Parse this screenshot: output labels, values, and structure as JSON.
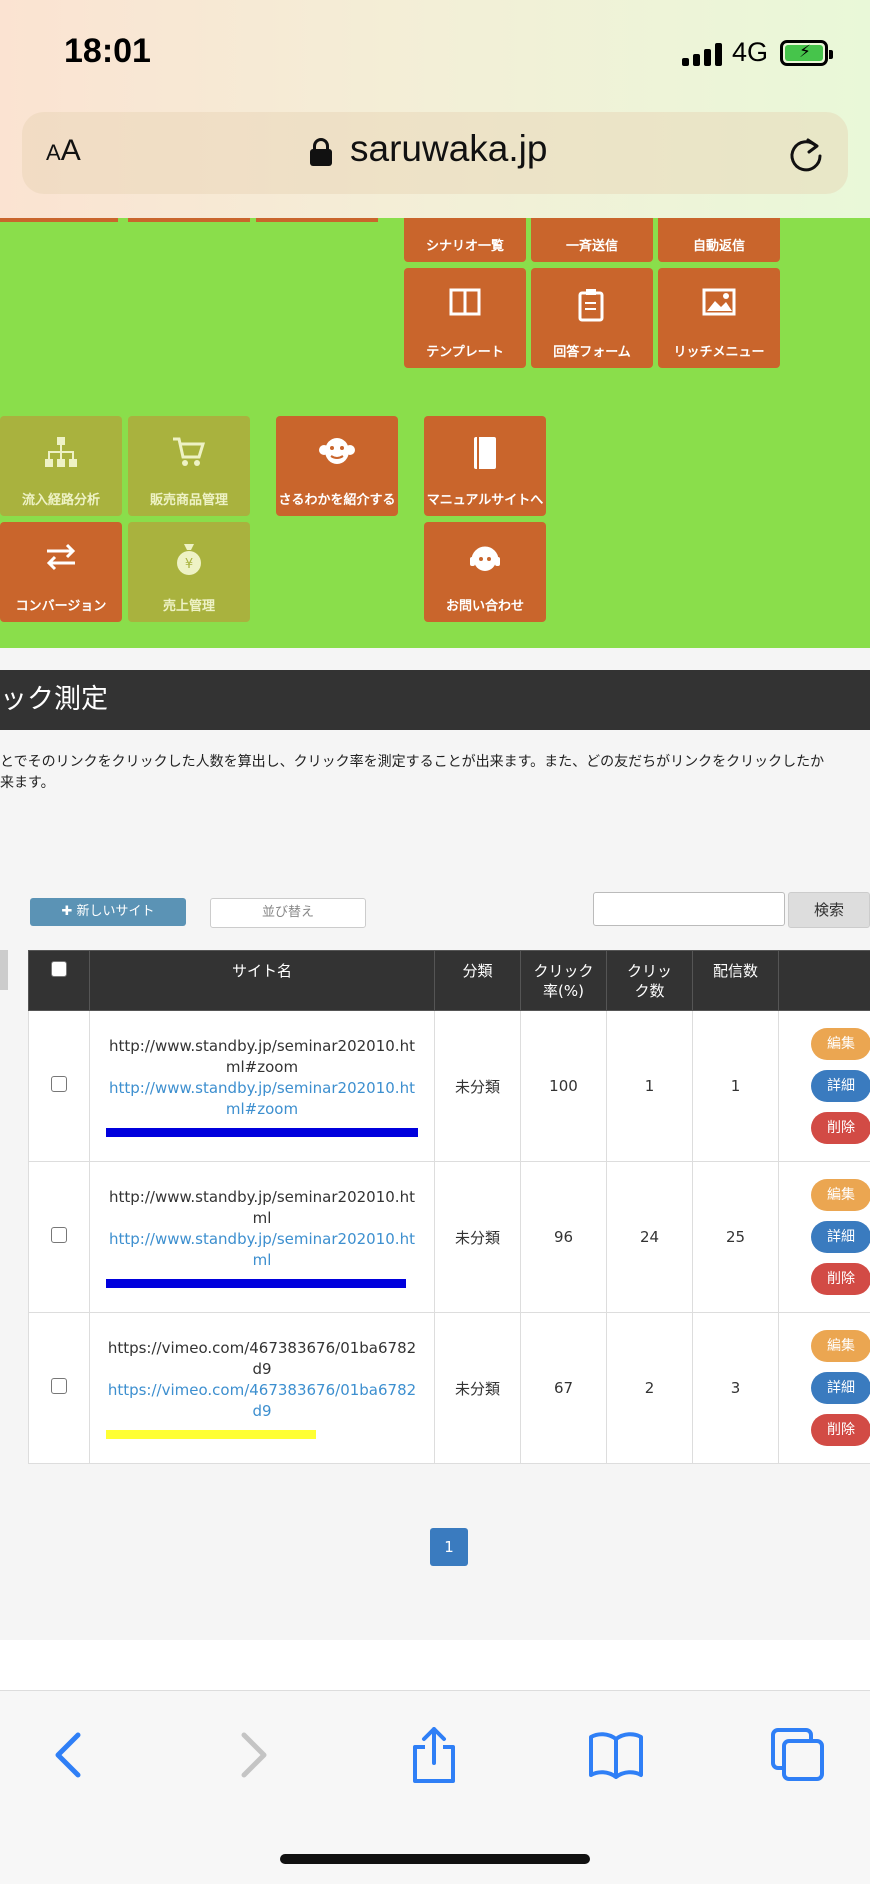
{
  "status_bar": {
    "time": "18:01",
    "network": "4G"
  },
  "browser": {
    "text_size_label": "AA",
    "domain": "saruwaka.jp"
  },
  "menu_tiles": {
    "row_top": [
      "シナリオ一覧",
      "一斉送信",
      "自動返信"
    ],
    "row_second": [
      "テンプレート",
      "回答フォーム",
      "リッチメニュー"
    ],
    "row_third": [
      "流入経路分析",
      "販売商品管理",
      "さるわかを紹介する",
      "マニュアルサイトへ"
    ],
    "row_fourth": [
      "コンバージョン",
      "売上管理",
      "お問い合わせ"
    ]
  },
  "page": {
    "title": "ック測定",
    "description_line1": "とでそのリンクをクリックした人数を算出し、クリック率を測定することが出来ます。また、どの友だちがリンクをクリックしたか",
    "description_line2": "来ます。"
  },
  "toolbar": {
    "new_site_label": "新しいサイト",
    "sort_label": "並び替え",
    "search_value": "",
    "search_button": "検索"
  },
  "table": {
    "headers": {
      "site": "サイト名",
      "category": "分類",
      "click_rate": "クリック率(%)",
      "clicks": "クリック数",
      "deliveries": "配信数"
    },
    "rows": [
      {
        "title": "http://www.standby.jp/seminar202010.html#zoom",
        "url": "http://www.standby.jp/seminar202010.html#zoom",
        "category": "未分類",
        "rate": "100",
        "clicks": "1",
        "deliveries": "1",
        "highlight": "#0000dd"
      },
      {
        "title": "http://www.standby.jp/seminar202010.html",
        "url": "http://www.standby.jp/seminar202010.html",
        "category": "未分類",
        "rate": "96",
        "clicks": "24",
        "deliveries": "25",
        "highlight": "#0000dd"
      },
      {
        "title": "https://vimeo.com/467383676/01ba6782d9",
        "url": "https://vimeo.com/467383676/01ba6782d9",
        "category": "未分類",
        "rate": "67",
        "clicks": "2",
        "deliveries": "3",
        "highlight": "#ffff33"
      }
    ],
    "actions": {
      "edit": "編集",
      "detail": "詳細",
      "delete": "削除"
    }
  },
  "pagination": {
    "current": "1"
  },
  "colors": {
    "green": "#8ade4b",
    "tile": "#c9652c",
    "tile_muted": "#a9b23e",
    "header": "#333333"
  }
}
